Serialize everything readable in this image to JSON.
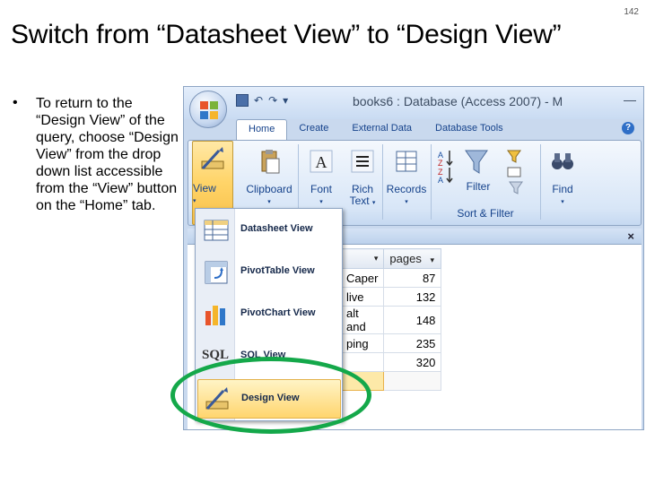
{
  "slide": {
    "page_number": "142",
    "title": "Switch from “Datasheet View” to “Design View”",
    "bullet": "•",
    "bullet_text": "To return to the “Design View” of the query, choose “Design View” from the drop down  list accessible from the “View” button on the “Home” tab."
  },
  "window": {
    "title": "books6 : Database (Access 2007) - M",
    "qat_undo": "↶",
    "qat_redo": "↷",
    "qat_more": "▾",
    "minimize": "—",
    "help": "?",
    "doc_close": "×"
  },
  "ribbon": {
    "tabs": [
      "Home",
      "Create",
      "External Data",
      "Database Tools"
    ],
    "groups": {
      "view": "View",
      "clipboard": "Clipboard",
      "font": "Font",
      "rich_text_1": "Rich",
      "rich_text_2": "Text",
      "records": "Records",
      "filter": "Filter",
      "sort_filter": "Sort & Filter",
      "find": "Find"
    },
    "caret": "▾"
  },
  "view_menu": {
    "items": [
      {
        "label": "Datasheet View",
        "icon": "datasheet-icon"
      },
      {
        "label": "PivotTable View",
        "icon": "pivottable-icon"
      },
      {
        "label": "PivotChart View",
        "icon": "pivotchart-icon"
      },
      {
        "label": "SQL View",
        "icon": "sql-icon"
      },
      {
        "label": "Design View",
        "icon": "design-view-icon",
        "highlighted": true
      }
    ],
    "sql_icon_text": "SQL"
  },
  "datasheet": {
    "header_a": "",
    "header_a_caret": "▾",
    "header_b": "pages",
    "header_b_caret": "▾",
    "rows": [
      {
        "a": "Caper",
        "pages": "87"
      },
      {
        "a": "live",
        "pages": "132"
      },
      {
        "a": "alt and",
        "pages": "148"
      },
      {
        "a": "ping",
        "pages": "235"
      },
      {
        "a": "",
        "pages": "320"
      }
    ]
  },
  "colors": {
    "highlight_circle": "#14a84a",
    "ribbon_text": "#15428b",
    "menu_highlight": "#ffd56e"
  }
}
